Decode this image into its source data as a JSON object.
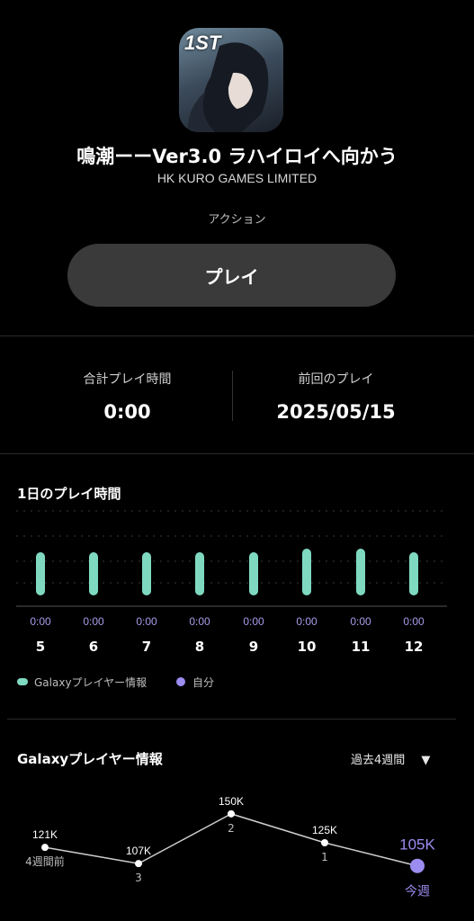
{
  "app": {
    "badge": "1ST",
    "title": "鳴潮ーーVer3.0 ラハイロイへ向かう",
    "developer": "HK KURO GAMES LIMITED",
    "genre": "アクション",
    "play_label": "プレイ"
  },
  "stats": {
    "total_label": "合計プレイ時間",
    "total_value": "0:00",
    "last_label": "前回のプレイ",
    "last_value": "2025/05/15"
  },
  "daily": {
    "title": "1日のプレイ時間",
    "days": [
      {
        "day": "5",
        "time": "0:00"
      },
      {
        "day": "6",
        "time": "0:00"
      },
      {
        "day": "7",
        "time": "0:00"
      },
      {
        "day": "8",
        "time": "0:00"
      },
      {
        "day": "9",
        "time": "0:00"
      },
      {
        "day": "10",
        "time": "0:00"
      },
      {
        "day": "11",
        "time": "0:00"
      },
      {
        "day": "12",
        "time": "0:00"
      }
    ],
    "legend_galaxy": "Galaxyプレイヤー情報",
    "legend_self": "自分",
    "color_galaxy": "#7fd9c0",
    "color_self": "#9b8cf0"
  },
  "chart_data": {
    "type": "line",
    "title": "Galaxyプレイヤー情報",
    "period_label": "過去4週間",
    "categories": [
      "4週間前",
      "3",
      "2",
      "1",
      "今週"
    ],
    "values": [
      121,
      107,
      150,
      125,
      105
    ],
    "value_labels": [
      "121K",
      "107K",
      "150K",
      "125K",
      "105K"
    ],
    "ylim": [
      90,
      160
    ]
  }
}
